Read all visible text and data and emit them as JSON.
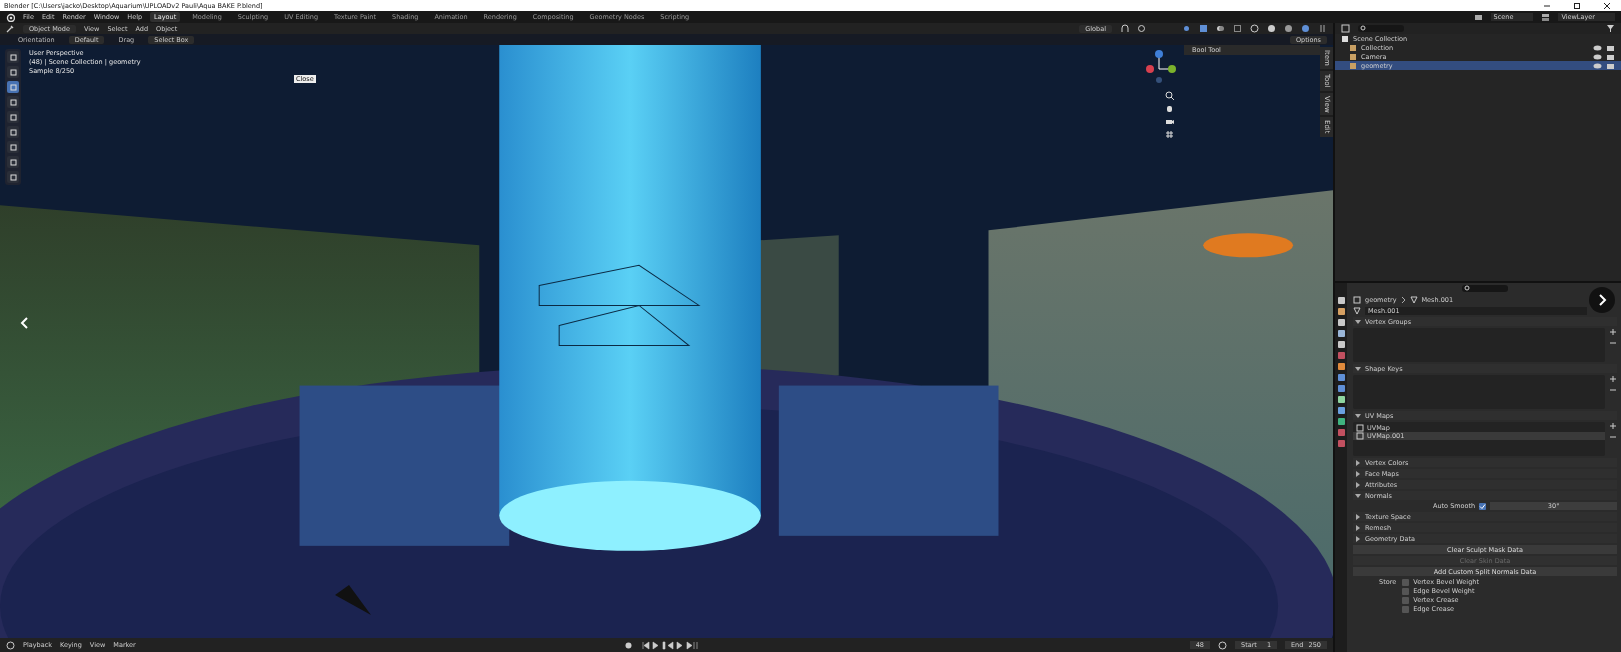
{
  "window": {
    "title": "Blender [C:\\Users\\jacko\\Desktop\\Aquarium\\UPLOADv2 Pauli\\Aqua BAKE P.blend]"
  },
  "menu": [
    "File",
    "Edit",
    "Render",
    "Window",
    "Help"
  ],
  "workspaces": [
    {
      "label": "Layout",
      "selected": true
    },
    {
      "label": "Modeling",
      "selected": false
    },
    {
      "label": "Sculpting",
      "selected": false
    },
    {
      "label": "UV Editing",
      "selected": false
    },
    {
      "label": "Texture Paint",
      "selected": false
    },
    {
      "label": "Shading",
      "selected": false
    },
    {
      "label": "Animation",
      "selected": false
    },
    {
      "label": "Rendering",
      "selected": false
    },
    {
      "label": "Compositing",
      "selected": false
    },
    {
      "label": "Geometry Nodes",
      "selected": false
    },
    {
      "label": "Scripting",
      "selected": false
    }
  ],
  "scene": {
    "scene_name": "Scene",
    "view_layer": "ViewLayer"
  },
  "header": {
    "mode": "Object Mode",
    "menus": [
      "View",
      "Select",
      "Add",
      "Object"
    ],
    "transform": "Global"
  },
  "tool_settings": {
    "orientation_label": "Orientation",
    "orientation": "Default",
    "drag_label": "Drag",
    "drag": "Select Box",
    "options": "Options"
  },
  "viewport": {
    "overlay": [
      "User Perspective",
      "(48) | Scene Collection | geometry",
      "Sample 8/250"
    ],
    "tooltip": "Close",
    "npanel_header": "Bool Tool",
    "tools": [
      {
        "selected": false
      },
      {
        "selected": false
      },
      {
        "selected": true
      },
      {
        "selected": false
      },
      {
        "selected": false
      },
      {
        "selected": false
      },
      {
        "selected": false
      },
      {
        "selected": false
      },
      {
        "selected": false
      }
    ],
    "tabs": [
      "Item",
      "Tool",
      "View",
      "Edit"
    ]
  },
  "outliner": {
    "root": "Scene Collection",
    "items": [
      {
        "name": "Collection",
        "selected": false
      },
      {
        "name": "Camera",
        "selected": false
      },
      {
        "name": "geometry",
        "selected": true
      }
    ]
  },
  "properties": {
    "object": "geometry",
    "mesh": "Mesh.001",
    "datablock": "Mesh.001",
    "panels": [
      {
        "title": "Vertex Groups",
        "expanded": true,
        "kind": "list"
      },
      {
        "title": "Shape Keys",
        "expanded": true,
        "kind": "list"
      },
      {
        "title": "UV Maps",
        "expanded": true,
        "kind": "list",
        "rows": [
          {
            "name": "UVMap",
            "selected": false
          },
          {
            "name": "UVMap.001",
            "selected": true
          }
        ]
      },
      {
        "title": "Vertex Colors",
        "expanded": false
      },
      {
        "title": "Face Maps",
        "expanded": false
      },
      {
        "title": "Attributes",
        "expanded": false
      },
      {
        "title": "Normals",
        "expanded": true,
        "kind": "normals",
        "label": "Auto Smooth",
        "checked": true,
        "value": "30°"
      },
      {
        "title": "Texture Space",
        "expanded": false
      },
      {
        "title": "Remesh",
        "expanded": false
      },
      {
        "title": "Geometry Data",
        "expanded": false
      }
    ],
    "buttons": [
      {
        "label": "Clear Sculpt Mask Data",
        "disabled": false
      },
      {
        "label": "Clear Skin Data",
        "disabled": true
      },
      {
        "label": "Add Custom Split Normals Data",
        "disabled": false
      }
    ],
    "store_label": "Store",
    "store": [
      {
        "label": "Vertex Bevel Weight",
        "checked": false
      },
      {
        "label": "Edge Bevel Weight",
        "checked": false
      },
      {
        "label": "Vertex Crease",
        "checked": false
      },
      {
        "label": "Edge Crease",
        "checked": false
      }
    ]
  },
  "timeline": {
    "menus": [
      "Playback",
      "Keying",
      "View",
      "Marker"
    ],
    "frame": "48",
    "start_label": "Start",
    "start": "1",
    "end_label": "End",
    "end": "250"
  }
}
